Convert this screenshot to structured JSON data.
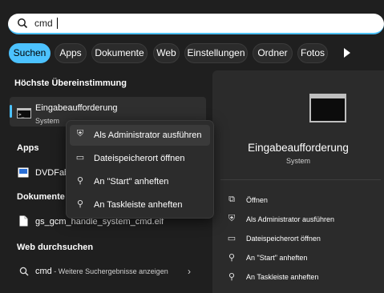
{
  "search": {
    "query": "cmd"
  },
  "tabs": [
    {
      "label": "Suchen",
      "active": true
    },
    {
      "label": "Apps"
    },
    {
      "label": "Dokumente"
    },
    {
      "label": "Web"
    },
    {
      "label": "Einstellungen"
    },
    {
      "label": "Ordner"
    },
    {
      "label": "Fotos"
    }
  ],
  "results": {
    "best_match_header": "Höchste Übereinstimmung",
    "best_match": {
      "title": "Eingabeaufforderung",
      "subtitle": "System"
    },
    "apps_header": "Apps",
    "app_item": "DVDFab",
    "documents_header": "Dokumente",
    "document_item": "gs_gcm_handle_system_cmd.elf",
    "web_header": "Web durchsuchen",
    "web_item": {
      "query": "cmd",
      "suffix": " - Weitere Suchergebnisse anzeigen"
    }
  },
  "context_menu": {
    "items": [
      {
        "label": "Als Administrator ausführen",
        "icon": "shield-window-icon"
      },
      {
        "label": "Dateispeicherort öffnen",
        "icon": "folder-icon"
      },
      {
        "label": "An \"Start\" anheften",
        "icon": "pin-icon"
      },
      {
        "label": "An Taskleiste anheften",
        "icon": "pin-icon"
      }
    ]
  },
  "detail": {
    "title": "Eingabeaufforderung",
    "subtitle": "System",
    "actions": [
      {
        "label": "Öffnen",
        "icon": "open-external-icon"
      },
      {
        "label": "Als Administrator ausführen",
        "icon": "shield-window-icon"
      },
      {
        "label": "Dateispeicherort öffnen",
        "icon": "folder-icon"
      },
      {
        "label": "An \"Start\" anheften",
        "icon": "pin-icon"
      },
      {
        "label": "An Taskleiste anheften",
        "icon": "pin-icon"
      }
    ]
  },
  "colors": {
    "accent": "#4cc2ff",
    "background": "#1f1f1f",
    "pane": "#2b2b2b"
  }
}
